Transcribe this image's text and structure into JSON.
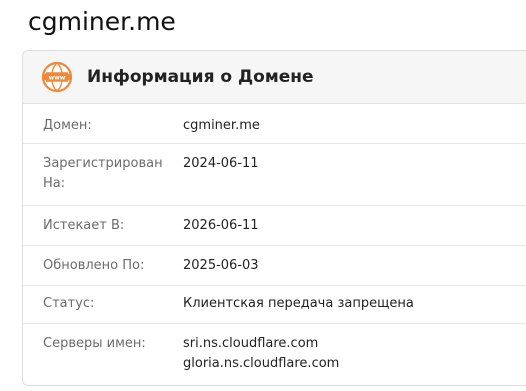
{
  "page": {
    "title": "cgminer.me"
  },
  "panel": {
    "icon": "www-globe-icon",
    "title": "Информация о Домене",
    "accent_color": "#f0883a"
  },
  "rows": [
    {
      "label": "Домен:",
      "value": "cgminer.me"
    },
    {
      "label": "Зарегистрирован На:",
      "value": "2024-06-11"
    },
    {
      "label": "Истекает В:",
      "value": "2026-06-11"
    },
    {
      "label": "Обновлено По:",
      "value": "2025-06-03"
    },
    {
      "label": "Статус:",
      "value": "Клиентская передача запрещена"
    },
    {
      "label": "Серверы имен:",
      "values": [
        "sri.ns.cloudflare.com",
        "gloria.ns.cloudflare.com"
      ]
    }
  ]
}
